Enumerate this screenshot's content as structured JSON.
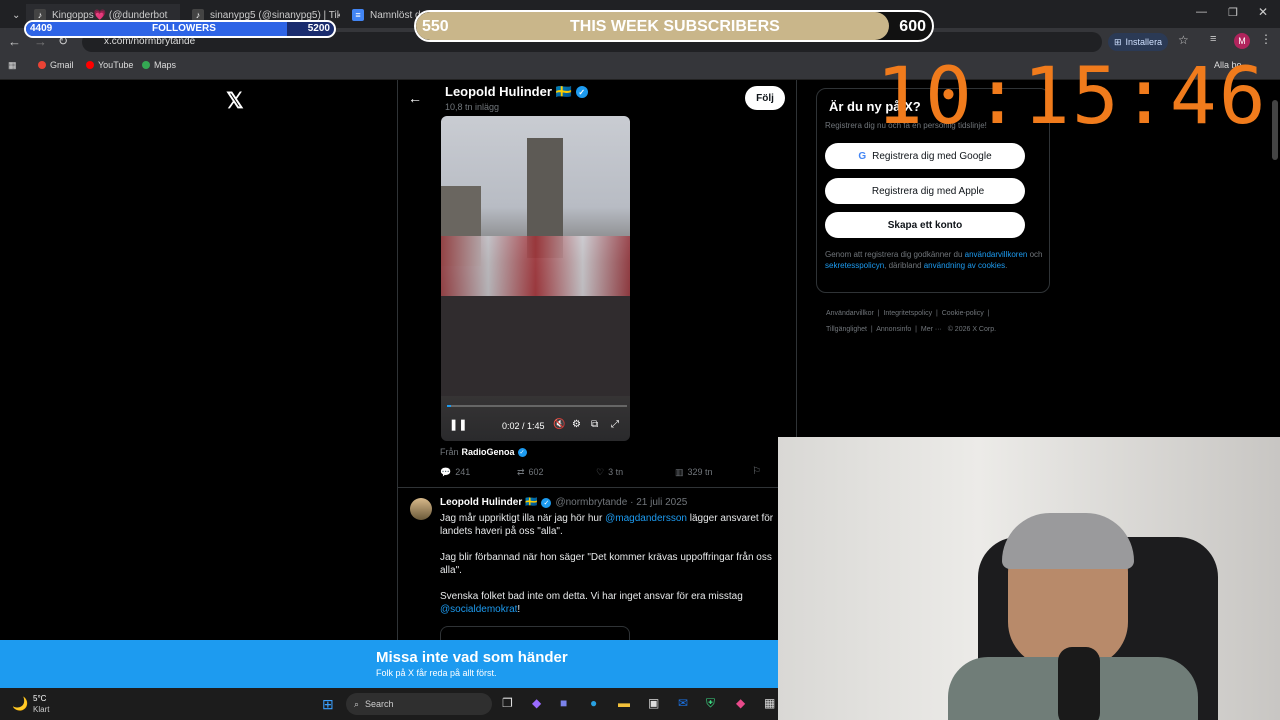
{
  "browser": {
    "tabs": [
      {
        "label": "Kingopps💗 (@dunderbot",
        "icon": "tiktok-icon"
      },
      {
        "label": "sinanypg5 (@sinanypg5) | TikTo",
        "icon": "tiktok-icon"
      },
      {
        "label": "Namnlöst doku",
        "icon": "docs-icon"
      }
    ],
    "url": "x.com/normbrytande",
    "install_label": "Installera",
    "profile_initial": "M",
    "bookmarks": [
      "Gmail",
      "YouTube",
      "Maps"
    ],
    "all_bookmarks": "Alla bo..."
  },
  "overlay": {
    "followers": {
      "label": "FOLLOWERS",
      "current": "4409",
      "goal": "5200",
      "progress": 0.848
    },
    "subscribers": {
      "label": "THIS WEEK SUBSCRIBERS",
      "current": "550",
      "goal": "600",
      "progress": 0.917
    },
    "clock": "10:15:46"
  },
  "profile_header": {
    "name": "Leopold Hulinder 🇸🇪",
    "posts": "10,8 tn inlägg",
    "follow": "Följ"
  },
  "video": {
    "time": "0:02 / 1:45",
    "source_prefix": "Från",
    "source": "RadioGenoa",
    "progress": 0.02
  },
  "first_tweet_stats": {
    "replies": "241",
    "reposts": "602",
    "likes": "3 tn",
    "views": "329 tn"
  },
  "tweet2": {
    "name": "Leopold Hulinder 🇸🇪",
    "handle": "@normbrytande · 21 juli 2025",
    "line1_a": "Jag mår uppriktigt illa när jag hör hur",
    "mention1": "@magdandersson",
    "line1_b": "lägger ansvaret för",
    "line2": "landets haveri på oss \"alla\".",
    "para2": "Jag blir förbannad när hon säger \"Det kommer krävas uppoffringar från oss alla\".",
    "para3": "Svenska folket bad inte om detta. Vi har inget ansvar för era misstag",
    "mention2": "@socialdemokrat",
    "end": "!"
  },
  "signup": {
    "title": "Är du ny på X?",
    "subtitle": "Registrera dig nu och få en personlig tidslinje!",
    "google": "Registrera dig med Google",
    "apple": "Registrera dig med Apple",
    "create": "Skapa ett konto",
    "terms_a": "Genom att registrera dig godkänner du",
    "terms_link1": "användarvillkoren",
    "terms_b": "och",
    "terms_link2": "sekretesspolicyn",
    "terms_c": ", däribland",
    "terms_link3": "användning av cookies",
    "terms_d": "."
  },
  "footer_links": [
    "Användarvillkor",
    "Integritetspolicy",
    "Cookie-policy",
    "Tillgänglighet",
    "Annonsinfo",
    "Mer ···",
    "© 2026 X Corp."
  ],
  "banner": {
    "title": "Missa inte vad som händer",
    "subtitle": "Folk på X får reda på allt först."
  },
  "taskbar": {
    "temp": "5°C",
    "weather": "Klart",
    "search": "Search"
  }
}
